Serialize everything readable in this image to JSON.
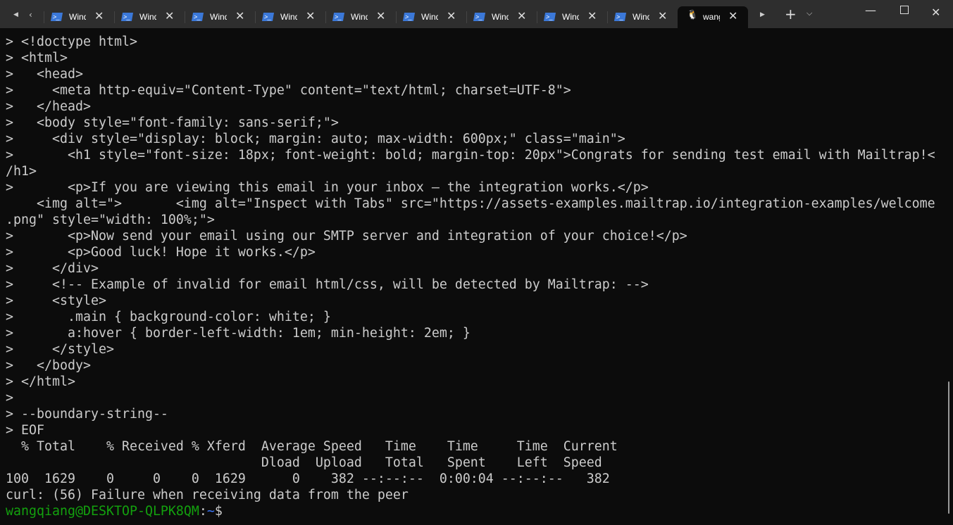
{
  "tabs": [
    {
      "label": "Windows PowerShell",
      "icon": "powershell-icon"
    },
    {
      "label": "Windows PowerShell",
      "icon": "powershell-icon"
    },
    {
      "label": "Windows PowerShell",
      "icon": "powershell-icon"
    },
    {
      "label": "Windows PowerShell",
      "icon": "powershell-icon"
    },
    {
      "label": "Windows PowerShell",
      "icon": "powershell-icon"
    },
    {
      "label": "Windows PowerShell",
      "icon": "powershell-icon"
    },
    {
      "label": "Windows PowerShell",
      "icon": "powershell-icon"
    },
    {
      "label": "Windows PowerShell",
      "icon": "powershell-icon"
    },
    {
      "label": "Windows PowerShell",
      "icon": "powershell-icon"
    },
    {
      "label": "wangqiang",
      "icon": "linux-penguin-icon",
      "active": true
    }
  ],
  "terminal": {
    "lines": [
      "> <!doctype html>",
      "> <html>",
      ">   <head>",
      ">     <meta http-equiv=\"Content-Type\" content=\"text/html; charset=UTF-8\">",
      ">   </head>",
      ">   <body style=\"font-family: sans-serif;\">",
      ">     <div style=\"display: block; margin: auto; max-width: 600px;\" class=\"main\">",
      ">       <h1 style=\"font-size: 18px; font-weight: bold; margin-top: 20px\">Congrats for sending test email with Mailtrap!<",
      "/h1>",
      ">       <p>If you are viewing this email in your inbox – the integration works.</p>",
      "    <img alt=\">       <img alt=\"Inspect with Tabs\" src=\"https://assets-examples.mailtrap.io/integration-examples/welcome",
      ".png\" style=\"width: 100%;\">",
      ">       <p>Now send your email using our SMTP server and integration of your choice!</p>",
      ">       <p>Good luck! Hope it works.</p>",
      ">     </div>",
      ">     <!-- Example of invalid for email html/css, will be detected by Mailtrap: -->",
      ">     <style>",
      ">       .main { background-color: white; }",
      ">       a:hover { border-left-width: 1em; min-height: 2em; }",
      ">     </style>",
      ">   </body>",
      "> </html>",
      ">",
      "> --boundary-string--",
      "> EOF",
      "  % Total    % Received % Xferd  Average Speed   Time    Time     Time  Current",
      "                                 Dload  Upload   Total   Spent    Left  Speed",
      "100  1629    0     0    0  1629      0    382 --:--:--  0:00:04 --:--:--   382",
      "curl: (56) Failure when receiving data from the peer"
    ],
    "prompt": {
      "user_host": "wangqiang@DESKTOP-QLPK8QM",
      "colon": ":",
      "path": "~",
      "symbol": "$"
    }
  }
}
